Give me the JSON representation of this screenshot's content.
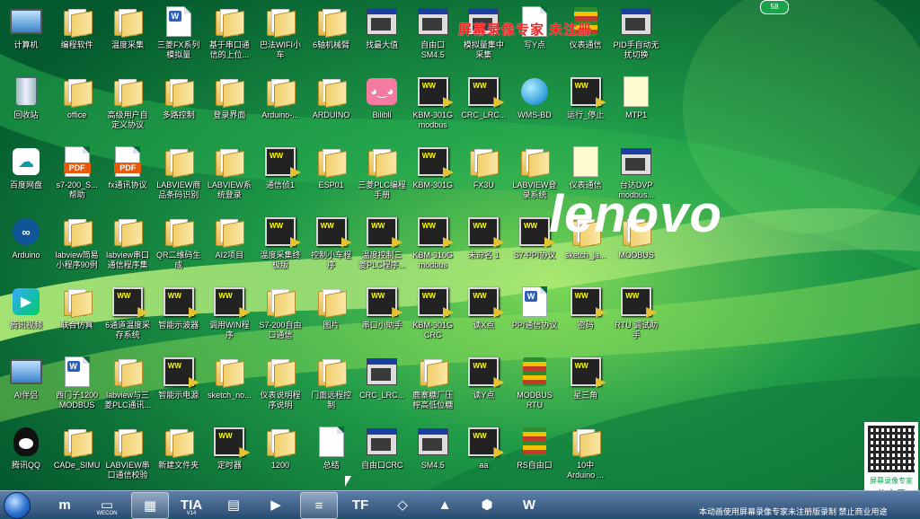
{
  "overlay": {
    "watermark": "屏幕录像专家 未注册",
    "brand": "lenovo",
    "badge": "58",
    "qr_line1": "屏幕录像专家",
    "qr_line2": "公众号"
  },
  "taskbar": {
    "notice": "本动画使用屏幕录像专家未注册版录制 禁止商业用途",
    "items": [
      {
        "name": "magnet",
        "glyph": "m",
        "sub": ""
      },
      {
        "name": "wecon",
        "glyph": "▭",
        "sub": "WECON"
      },
      {
        "name": "window-app",
        "glyph": "▦",
        "sub": ""
      },
      {
        "name": "tia",
        "glyph": "TIA",
        "sub": "V14"
      },
      {
        "name": "panel",
        "glyph": "▤",
        "sub": ""
      },
      {
        "name": "player",
        "glyph": "▶",
        "sub": ""
      },
      {
        "name": "stack",
        "glyph": "≡",
        "sub": ""
      },
      {
        "name": "tf",
        "glyph": "TF",
        "sub": ""
      },
      {
        "name": "vs",
        "glyph": "◇",
        "sub": ""
      },
      {
        "name": "warn",
        "glyph": "▲",
        "sub": ""
      },
      {
        "name": "shield",
        "glyph": "⬢",
        "sub": ""
      },
      {
        "name": "wps",
        "glyph": "W",
        "sub": ""
      }
    ]
  },
  "icons": [
    {
      "label": "计算机",
      "type": "monitor"
    },
    {
      "label": "编程软件",
      "type": "folder"
    },
    {
      "label": "温度采集",
      "type": "folder"
    },
    {
      "label": "三菱FX系列\n模拟量",
      "type": "doc-word"
    },
    {
      "label": "基于串口通\n信的上位...",
      "type": "folder"
    },
    {
      "label": "巴法WIFI小\n车",
      "type": "folder"
    },
    {
      "label": "6轴机械臂",
      "type": "folder"
    },
    {
      "label": "找最大值",
      "type": "win"
    },
    {
      "label": "自由口\nSM4.5",
      "type": "win"
    },
    {
      "label": "模拟量集中\n采集",
      "type": "win"
    },
    {
      "label": "写Y点",
      "type": "doc"
    },
    {
      "label": "仪表通信",
      "type": "stack"
    },
    {
      "label": "PID手自动无\n扰切换",
      "type": "win"
    },
    {
      "label": "回收站",
      "type": "bin"
    },
    {
      "label": "office",
      "type": "folder"
    },
    {
      "label": "高级用户自\n定义协议",
      "type": "folder"
    },
    {
      "label": "多路控制",
      "type": "folder"
    },
    {
      "label": "登录界面",
      "type": "folder"
    },
    {
      "label": "Arduino-...",
      "type": "folder"
    },
    {
      "label": "ARDUINO",
      "type": "folder"
    },
    {
      "label": "Bilibli",
      "type": "bili"
    },
    {
      "label": "KBM-301G\nmodbus",
      "type": "vi"
    },
    {
      "label": "CRC_LRC...",
      "type": "vi"
    },
    {
      "label": "WMS-BD",
      "type": "globe"
    },
    {
      "label": "运行_停止",
      "type": "vi"
    },
    {
      "label": "MTP1",
      "type": "notepad"
    },
    {
      "label": "百度网盘",
      "type": "cloud"
    },
    {
      "label": "s7-200_S...\n帮助",
      "type": "pdf"
    },
    {
      "label": "fx通讯协议",
      "type": "pdf"
    },
    {
      "label": "LABVIEW商\n品条码识别",
      "type": "folder"
    },
    {
      "label": "LABVIEW系\n统登录",
      "type": "folder"
    },
    {
      "label": "通信侦1",
      "type": "vi"
    },
    {
      "label": "ESP01",
      "type": "folder"
    },
    {
      "label": "三菱PLC编程\n手册",
      "type": "folder"
    },
    {
      "label": "KBM-301G",
      "type": "vi"
    },
    {
      "label": "FX3U",
      "type": "folder"
    },
    {
      "label": "LABVIEW登\n录系统",
      "type": "folder"
    },
    {
      "label": "仪表通信",
      "type": "notepad"
    },
    {
      "label": "台达DVP\nmodbus...",
      "type": "win"
    },
    {
      "label": "Arduino",
      "type": "arduino"
    },
    {
      "label": "labview简易\n小程序90例",
      "type": "folder"
    },
    {
      "label": "labview串口\n通信程序集",
      "type": "folder"
    },
    {
      "label": "QR二维码生\n成",
      "type": "folder"
    },
    {
      "label": "AI2项目",
      "type": "folder"
    },
    {
      "label": "温度采集终\n极版",
      "type": "vi"
    },
    {
      "label": "控制小车程\n序",
      "type": "vi"
    },
    {
      "label": "温度控制三\n菱PLC程序...",
      "type": "vi"
    },
    {
      "label": "KBM-310G\nmodbus",
      "type": "vi"
    },
    {
      "label": "未命名 1",
      "type": "vi"
    },
    {
      "label": "S7-PPI协议",
      "type": "vi"
    },
    {
      "label": "sketch_ja...",
      "type": "folder"
    },
    {
      "label": "MODBUS",
      "type": "folder"
    },
    {
      "label": "腾讯视频",
      "type": "tencent"
    },
    {
      "label": "联合仿真",
      "type": "folder"
    },
    {
      "label": "6通道温度采\n存系统",
      "type": "vi"
    },
    {
      "label": "智能示波器",
      "type": "vi"
    },
    {
      "label": "调用WIN程\n序",
      "type": "vi"
    },
    {
      "label": "S7-200自由\n口通信",
      "type": "folder"
    },
    {
      "label": "图片",
      "type": "folder"
    },
    {
      "label": "串口小助手",
      "type": "vi"
    },
    {
      "label": "KBM-301G\nCRC",
      "type": "vi"
    },
    {
      "label": "读X点",
      "type": "vi"
    },
    {
      "label": "PPI通信协议",
      "type": "doc-word"
    },
    {
      "label": "密码",
      "type": "vi"
    },
    {
      "label": "RTU 调试助\n手",
      "type": "vi"
    },
    {
      "label": "AI伴侣",
      "type": "monitor"
    },
    {
      "label": "西门子1200\nMODBUS",
      "type": "doc-word"
    },
    {
      "label": "labview与三\n菱PLC通讯...",
      "type": "folder"
    },
    {
      "label": "智能示电源",
      "type": "vi"
    },
    {
      "label": "sketch_no...",
      "type": "folder"
    },
    {
      "label": "仪表说明程\n序说明",
      "type": "folder"
    },
    {
      "label": "门面远程控\n制",
      "type": "folder"
    },
    {
      "label": "CRC_LRC...",
      "type": "win"
    },
    {
      "label": "鹿寨糖厂压\n榨高低位糖",
      "type": "folder"
    },
    {
      "label": "读Y点",
      "type": "vi"
    },
    {
      "label": "MODBUS\nRTU",
      "type": "stack"
    },
    {
      "label": "星三角",
      "type": "vi"
    },
    {
      "label": "腾讯QQ",
      "type": "qq"
    },
    {
      "label": "CADe_SIMU",
      "type": "folder"
    },
    {
      "label": "LABVIEW串\n口通信校验",
      "type": "folder"
    },
    {
      "label": "新建文件夹",
      "type": "folder"
    },
    {
      "label": "定时器",
      "type": "vi"
    },
    {
      "label": "1200",
      "type": "folder"
    },
    {
      "label": "总结",
      "type": "doc"
    },
    {
      "label": "自由口CRC",
      "type": "win"
    },
    {
      "label": "SM4.5",
      "type": "win"
    },
    {
      "label": "aa",
      "type": "vi"
    },
    {
      "label": "RS自由口",
      "type": "stack"
    },
    {
      "label": "10中\nArduino ...",
      "type": "folder"
    }
  ]
}
